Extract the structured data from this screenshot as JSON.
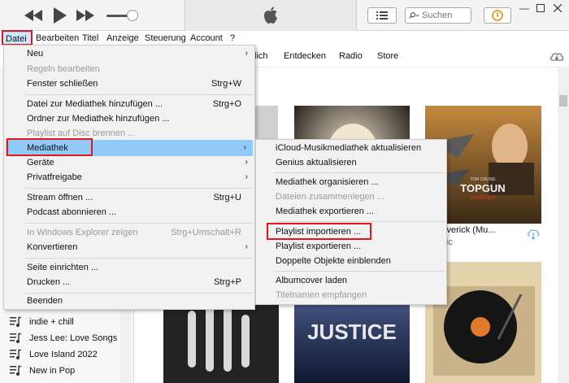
{
  "menubar": [
    "Datei",
    "Bearbeiten",
    "Titel",
    "Anzeige",
    "Steuerung",
    "Account",
    "?"
  ],
  "search": {
    "placeholder": "Suchen"
  },
  "nav_tabs": [
    "lich",
    "Entdecken",
    "Radio",
    "Store"
  ],
  "sidebar": {
    "playlists": [
      "indie + chill",
      "Jess Lee: Love Songs",
      "Love Island 2022",
      "New in Pop"
    ]
  },
  "album_card": {
    "title": "n: Maverick (Mu...",
    "artist": "epublic"
  },
  "cover_texts": {
    "top_gun_credit": "TOM CRUISE",
    "top_gun_title": "TOPGUN",
    "top_gun_subtitle": "MAVERICK",
    "justice": "JUSTICE"
  },
  "datei_menu": [
    {
      "label": "Neu",
      "shortcut": "",
      "submenu": true,
      "disabled": false
    },
    {
      "label": "Regeln bearbeiten",
      "shortcut": "",
      "submenu": false,
      "disabled": true
    },
    {
      "label": "Fenster schließen",
      "shortcut": "Strg+W",
      "submenu": false,
      "disabled": false
    },
    {
      "label": "Datei zur Mediathek hinzufügen ...",
      "shortcut": "Strg+O",
      "submenu": false,
      "disabled": false
    },
    {
      "label": "Ordner zur Mediathek hinzufügen ...",
      "shortcut": "",
      "submenu": false,
      "disabled": false
    },
    {
      "label": "Playlist auf Disc brennen ...",
      "shortcut": "",
      "submenu": false,
      "disabled": true
    },
    {
      "label": "Mediathek",
      "shortcut": "",
      "submenu": true,
      "disabled": false,
      "highlighted": true
    },
    {
      "label": "Geräte",
      "shortcut": "",
      "submenu": true,
      "disabled": false
    },
    {
      "label": "Privatfreigabe",
      "shortcut": "",
      "submenu": true,
      "disabled": false
    },
    {
      "label": "Stream öffnen ...",
      "shortcut": "Strg+U",
      "submenu": false,
      "disabled": false
    },
    {
      "label": "Podcast abonnieren ...",
      "shortcut": "",
      "submenu": false,
      "disabled": false
    },
    {
      "label": "In Windows Explorer zeigen",
      "shortcut": "Strg+Umschalt+R",
      "submenu": false,
      "disabled": true
    },
    {
      "label": "Konvertieren",
      "shortcut": "",
      "submenu": true,
      "disabled": false
    },
    {
      "label": "Seite einrichten ...",
      "shortcut": "",
      "submenu": false,
      "disabled": false
    },
    {
      "label": "Drucken ...",
      "shortcut": "Strg+P",
      "submenu": false,
      "disabled": false
    },
    {
      "label": "Beenden",
      "shortcut": "",
      "submenu": false,
      "disabled": false
    }
  ],
  "mediathek_submenu": [
    {
      "label": "iCloud-Musikmediathek aktualisieren",
      "disabled": false
    },
    {
      "label": "Genius aktualisieren",
      "disabled": false
    },
    {
      "label": "Mediathek organisieren ...",
      "disabled": false
    },
    {
      "label": "Dateien zusammenlegen ...",
      "disabled": true
    },
    {
      "label": "Mediathek exportieren ...",
      "disabled": false
    },
    {
      "label": "Playlist importieren ...",
      "disabled": false,
      "callout": true
    },
    {
      "label": "Playlist exportieren ...",
      "disabled": false
    },
    {
      "label": "Doppelte Objekte einblenden",
      "disabled": false
    },
    {
      "label": "Albumcover laden",
      "disabled": false
    },
    {
      "label": "Titelnamen empfangen",
      "disabled": true
    }
  ],
  "colors": {
    "highlight": "#91c9f7",
    "callout": "#e0181b",
    "disabled": "#9a9a9a"
  },
  "icons": [
    "previous-icon",
    "play-icon",
    "next-icon",
    "apple-logo-icon",
    "list-icon",
    "search-icon",
    "account-icon",
    "minimize-icon",
    "maximize-icon",
    "close-icon",
    "cloud-download-icon",
    "playlist-icon"
  ]
}
